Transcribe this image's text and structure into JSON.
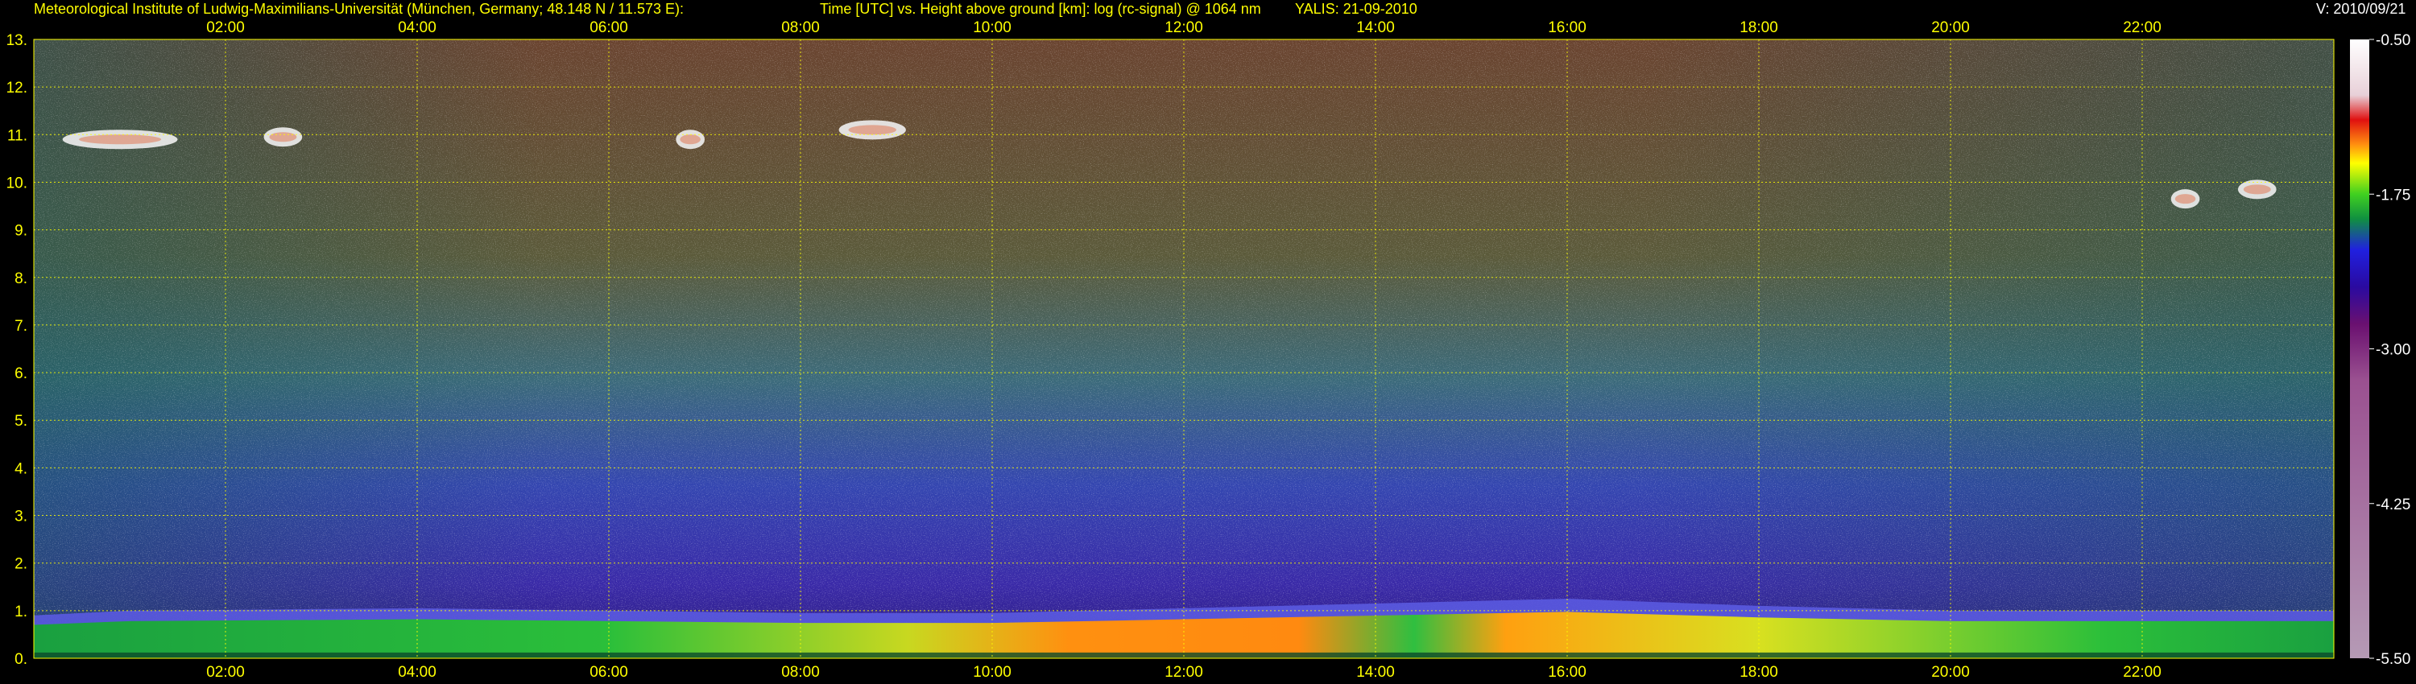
{
  "header": {
    "institute": "Meteorological Institute of Ludwig-Maximilians-Universität (München, Germany; 48.148 N / 11.573 E):",
    "plot_desc": "Time [UTC] vs. Height above ground [km]: log (rc-signal) @ 1064 nm",
    "instrument": "YALIS: 21-09-2010",
    "version": "V: 2010/09/21"
  },
  "colors": {
    "text": "#ffff00",
    "grid": "#ffff00",
    "background": "#000000"
  },
  "chart_data": {
    "type": "heatmap",
    "title": "Time [UTC] vs. Height above ground [km]: log (rc-signal) @ 1064 nm",
    "xlabel": "Time [UTC]",
    "ylabel": "Height above ground [km]",
    "xlim": [
      0,
      24
    ],
    "ylim": [
      0,
      13
    ],
    "x_ticks": [
      "02:00",
      "04:00",
      "06:00",
      "08:00",
      "10:00",
      "12:00",
      "14:00",
      "16:00",
      "18:00",
      "20:00",
      "22:00"
    ],
    "y_ticks": [
      "0.",
      "1.",
      "2.",
      "3.",
      "4.",
      "5.",
      "6.",
      "7.",
      "8.",
      "9.",
      "10.",
      "11.",
      "12.",
      "13."
    ],
    "grid": true,
    "colorbar": {
      "min": -5.5,
      "max": -0.5,
      "ticks": [
        "-0.50",
        "-1.75",
        "-3.00",
        "-4.25",
        "-5.50"
      ]
    },
    "features": {
      "boundary_layer_top_km": [
        {
          "t": 0,
          "h": 0.9
        },
        {
          "t": 1,
          "h": 1.0
        },
        {
          "t": 4,
          "h": 1.05
        },
        {
          "t": 8,
          "h": 0.95
        },
        {
          "t": 10,
          "h": 0.95
        },
        {
          "t": 12,
          "h": 1.05
        },
        {
          "t": 14,
          "h": 1.15
        },
        {
          "t": 16,
          "h": 1.25
        },
        {
          "t": 18,
          "h": 1.1
        },
        {
          "t": 20,
          "h": 1.0
        },
        {
          "t": 22,
          "h": 1.0
        },
        {
          "t": 24,
          "h": 1.0
        }
      ],
      "cirrus_clouds": [
        {
          "t_start": 0.3,
          "t_end": 1.5,
          "h": 10.9
        },
        {
          "t_start": 2.4,
          "t_end": 2.8,
          "h": 10.95
        },
        {
          "t_start": 6.7,
          "t_end": 7.0,
          "h": 10.9
        },
        {
          "t_start": 8.4,
          "t_end": 9.1,
          "h": 11.1
        },
        {
          "t_start": 22.3,
          "t_end": 22.6,
          "h": 9.65
        },
        {
          "t_start": 23.0,
          "t_end": 23.4,
          "h": 9.85
        }
      ]
    }
  }
}
